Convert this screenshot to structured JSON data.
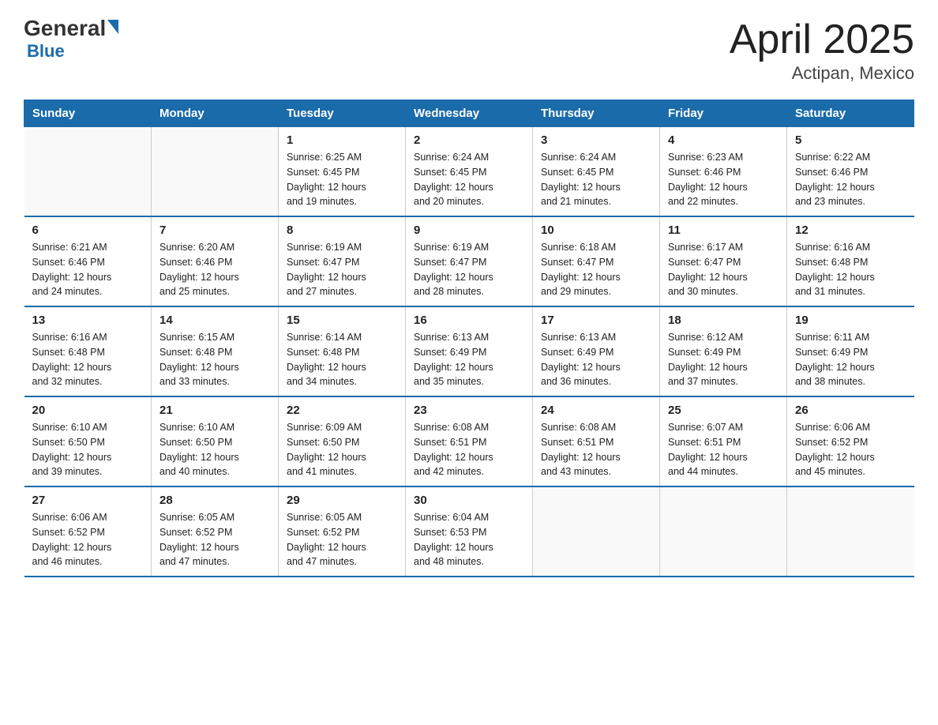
{
  "header": {
    "logo_general": "General",
    "logo_blue": "Blue",
    "title": "April 2025",
    "subtitle": "Actipan, Mexico"
  },
  "calendar": {
    "days_of_week": [
      "Sunday",
      "Monday",
      "Tuesday",
      "Wednesday",
      "Thursday",
      "Friday",
      "Saturday"
    ],
    "weeks": [
      [
        {
          "day": "",
          "info": ""
        },
        {
          "day": "",
          "info": ""
        },
        {
          "day": "1",
          "info": "Sunrise: 6:25 AM\nSunset: 6:45 PM\nDaylight: 12 hours\nand 19 minutes."
        },
        {
          "day": "2",
          "info": "Sunrise: 6:24 AM\nSunset: 6:45 PM\nDaylight: 12 hours\nand 20 minutes."
        },
        {
          "day": "3",
          "info": "Sunrise: 6:24 AM\nSunset: 6:45 PM\nDaylight: 12 hours\nand 21 minutes."
        },
        {
          "day": "4",
          "info": "Sunrise: 6:23 AM\nSunset: 6:46 PM\nDaylight: 12 hours\nand 22 minutes."
        },
        {
          "day": "5",
          "info": "Sunrise: 6:22 AM\nSunset: 6:46 PM\nDaylight: 12 hours\nand 23 minutes."
        }
      ],
      [
        {
          "day": "6",
          "info": "Sunrise: 6:21 AM\nSunset: 6:46 PM\nDaylight: 12 hours\nand 24 minutes."
        },
        {
          "day": "7",
          "info": "Sunrise: 6:20 AM\nSunset: 6:46 PM\nDaylight: 12 hours\nand 25 minutes."
        },
        {
          "day": "8",
          "info": "Sunrise: 6:19 AM\nSunset: 6:47 PM\nDaylight: 12 hours\nand 27 minutes."
        },
        {
          "day": "9",
          "info": "Sunrise: 6:19 AM\nSunset: 6:47 PM\nDaylight: 12 hours\nand 28 minutes."
        },
        {
          "day": "10",
          "info": "Sunrise: 6:18 AM\nSunset: 6:47 PM\nDaylight: 12 hours\nand 29 minutes."
        },
        {
          "day": "11",
          "info": "Sunrise: 6:17 AM\nSunset: 6:47 PM\nDaylight: 12 hours\nand 30 minutes."
        },
        {
          "day": "12",
          "info": "Sunrise: 6:16 AM\nSunset: 6:48 PM\nDaylight: 12 hours\nand 31 minutes."
        }
      ],
      [
        {
          "day": "13",
          "info": "Sunrise: 6:16 AM\nSunset: 6:48 PM\nDaylight: 12 hours\nand 32 minutes."
        },
        {
          "day": "14",
          "info": "Sunrise: 6:15 AM\nSunset: 6:48 PM\nDaylight: 12 hours\nand 33 minutes."
        },
        {
          "day": "15",
          "info": "Sunrise: 6:14 AM\nSunset: 6:48 PM\nDaylight: 12 hours\nand 34 minutes."
        },
        {
          "day": "16",
          "info": "Sunrise: 6:13 AM\nSunset: 6:49 PM\nDaylight: 12 hours\nand 35 minutes."
        },
        {
          "day": "17",
          "info": "Sunrise: 6:13 AM\nSunset: 6:49 PM\nDaylight: 12 hours\nand 36 minutes."
        },
        {
          "day": "18",
          "info": "Sunrise: 6:12 AM\nSunset: 6:49 PM\nDaylight: 12 hours\nand 37 minutes."
        },
        {
          "day": "19",
          "info": "Sunrise: 6:11 AM\nSunset: 6:49 PM\nDaylight: 12 hours\nand 38 minutes."
        }
      ],
      [
        {
          "day": "20",
          "info": "Sunrise: 6:10 AM\nSunset: 6:50 PM\nDaylight: 12 hours\nand 39 minutes."
        },
        {
          "day": "21",
          "info": "Sunrise: 6:10 AM\nSunset: 6:50 PM\nDaylight: 12 hours\nand 40 minutes."
        },
        {
          "day": "22",
          "info": "Sunrise: 6:09 AM\nSunset: 6:50 PM\nDaylight: 12 hours\nand 41 minutes."
        },
        {
          "day": "23",
          "info": "Sunrise: 6:08 AM\nSunset: 6:51 PM\nDaylight: 12 hours\nand 42 minutes."
        },
        {
          "day": "24",
          "info": "Sunrise: 6:08 AM\nSunset: 6:51 PM\nDaylight: 12 hours\nand 43 minutes."
        },
        {
          "day": "25",
          "info": "Sunrise: 6:07 AM\nSunset: 6:51 PM\nDaylight: 12 hours\nand 44 minutes."
        },
        {
          "day": "26",
          "info": "Sunrise: 6:06 AM\nSunset: 6:52 PM\nDaylight: 12 hours\nand 45 minutes."
        }
      ],
      [
        {
          "day": "27",
          "info": "Sunrise: 6:06 AM\nSunset: 6:52 PM\nDaylight: 12 hours\nand 46 minutes."
        },
        {
          "day": "28",
          "info": "Sunrise: 6:05 AM\nSunset: 6:52 PM\nDaylight: 12 hours\nand 47 minutes."
        },
        {
          "day": "29",
          "info": "Sunrise: 6:05 AM\nSunset: 6:52 PM\nDaylight: 12 hours\nand 47 minutes."
        },
        {
          "day": "30",
          "info": "Sunrise: 6:04 AM\nSunset: 6:53 PM\nDaylight: 12 hours\nand 48 minutes."
        },
        {
          "day": "",
          "info": ""
        },
        {
          "day": "",
          "info": ""
        },
        {
          "day": "",
          "info": ""
        }
      ]
    ]
  }
}
